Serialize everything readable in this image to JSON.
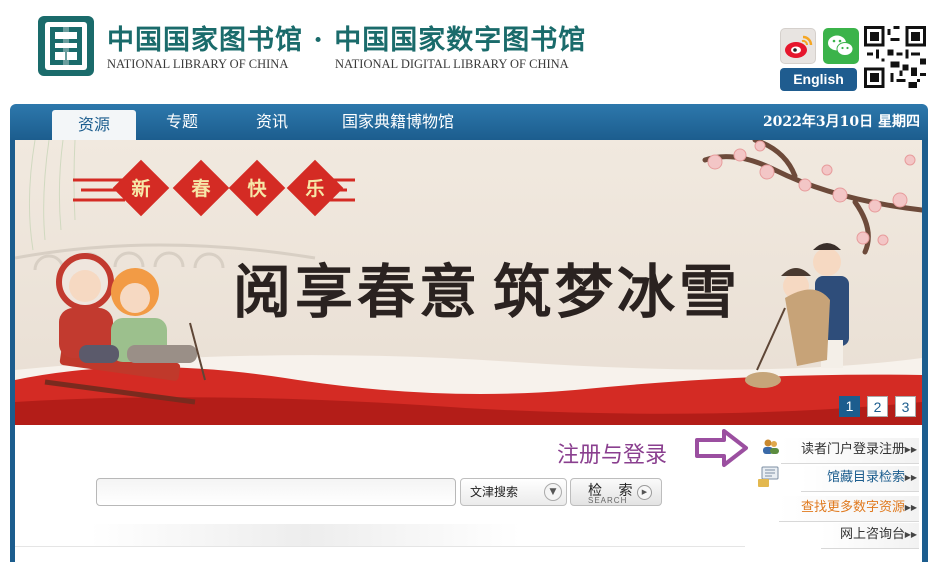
{
  "header": {
    "title_cn": "中国国家图书馆 · 中国国家数字图书馆",
    "title_en_left": "NATIONAL LIBRARY OF CHINA",
    "title_en_right": "NATIONAL DIGITAL  LIBRARY OF CHINA",
    "english_button": "English",
    "icons": [
      "weibo-icon",
      "wechat-icon",
      "qr-code"
    ]
  },
  "nav": {
    "items": [
      {
        "label": "资源",
        "active": true
      },
      {
        "label": "专题",
        "active": false
      },
      {
        "label": "资讯",
        "active": false
      },
      {
        "label": "国家典籍博物馆",
        "active": false
      }
    ],
    "date": "2022年3月10日  星期四"
  },
  "banner": {
    "greeting": [
      "新",
      "春",
      "快",
      "乐"
    ],
    "slogan_left": "阅享春意",
    "slogan_right": "筑梦冰雪",
    "pages": [
      "1",
      "2",
      "3"
    ],
    "active_page": "1"
  },
  "search": {
    "input_value": "",
    "select_value": "文津搜索",
    "button_main": "检 索",
    "button_sub": "SEARCH"
  },
  "side": {
    "register_hint": "注册与登录",
    "links": [
      {
        "label": "读者门户登录注册",
        "color": "#333333"
      },
      {
        "label": "馆藏目录检索",
        "color": "#1c5d8e"
      },
      {
        "label": "查找更多数字资源",
        "color": "#e07a1f"
      },
      {
        "label": "网上咨询台",
        "color": "#333333"
      }
    ]
  },
  "colors": {
    "brand": "#1c5d8e",
    "logo": "#1a6b6b",
    "festive_red": "#d42b24",
    "hint_purple": "#8a3f8f"
  }
}
